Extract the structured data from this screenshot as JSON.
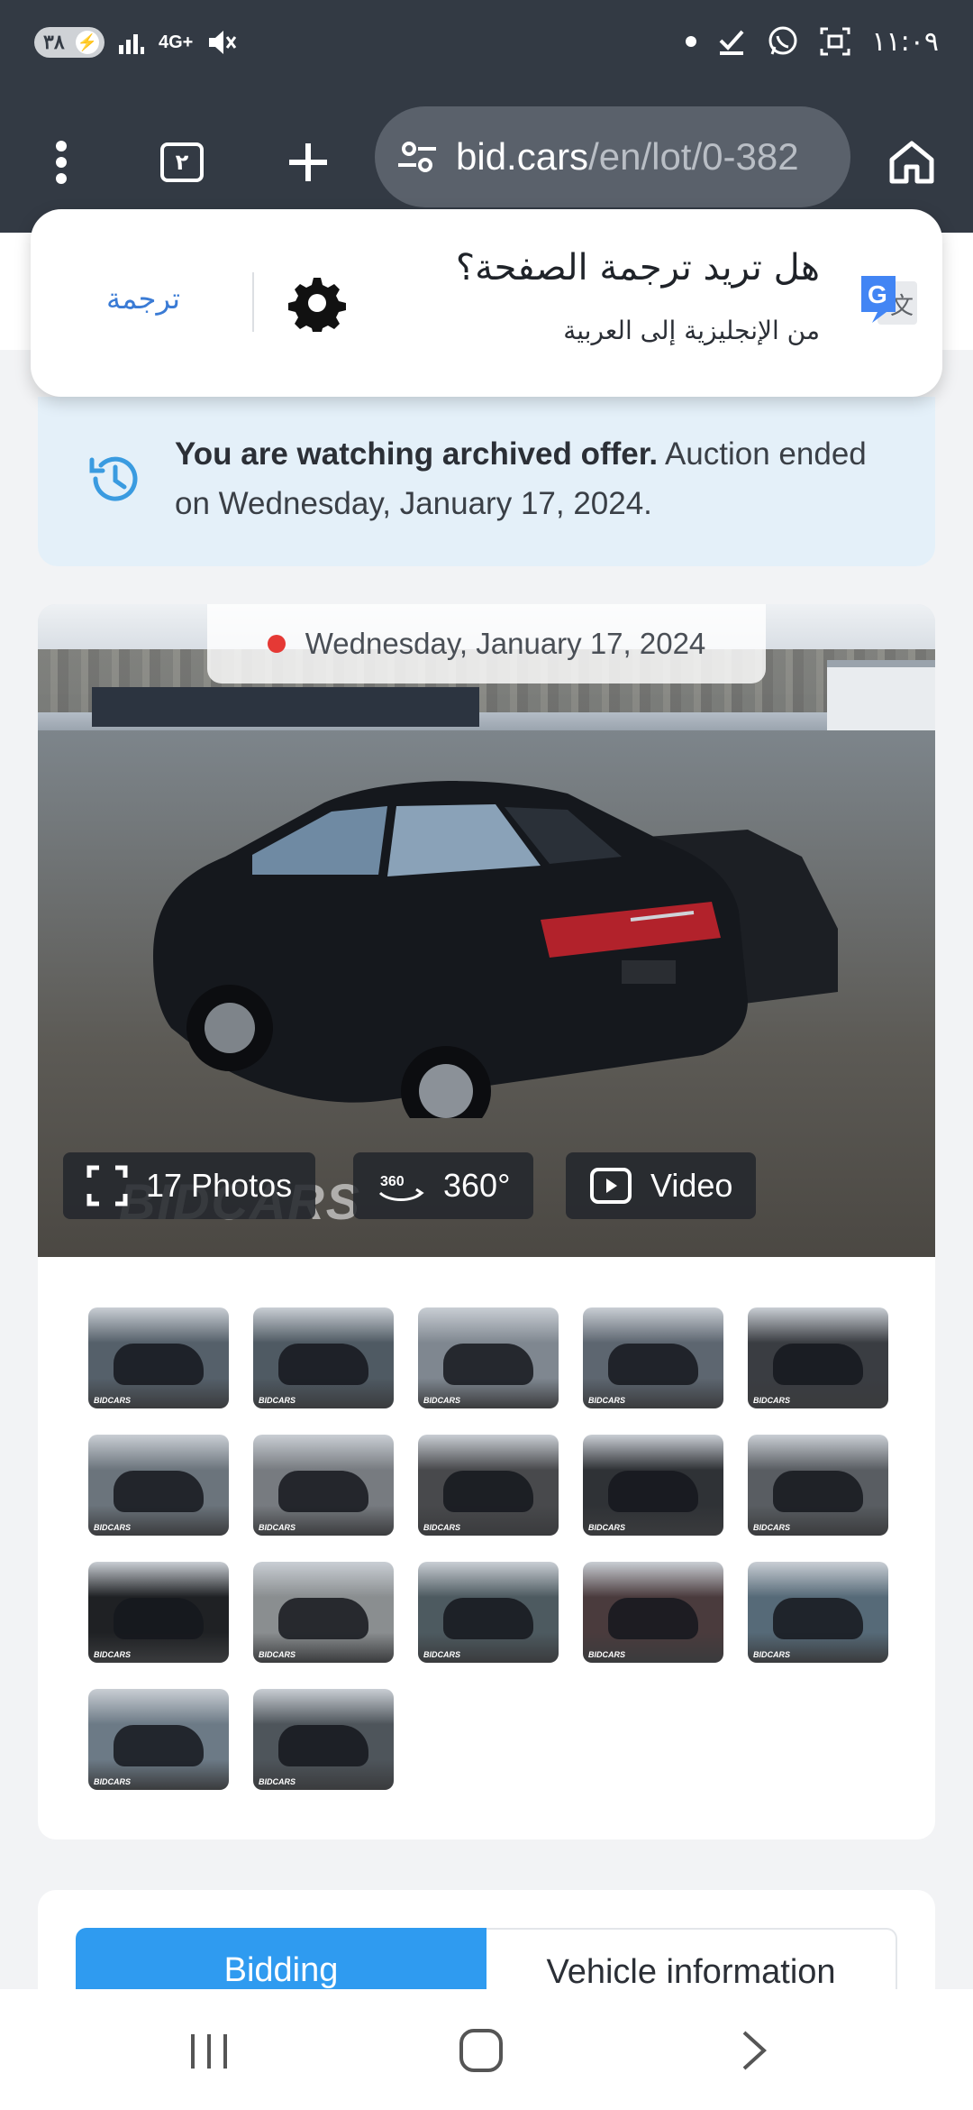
{
  "status_bar": {
    "battery": "٣٨",
    "network": "4G+",
    "time": "١١:٠٩"
  },
  "browser": {
    "tab_count": "٢",
    "url_host": "bid.cars",
    "url_path": "/en/lot/0-382"
  },
  "translate_popup": {
    "title": "هل تريد ترجمة الصفحة؟",
    "subtitle": "من الإنجليزية إلى العربية",
    "translate_button": "ترجمة"
  },
  "notice": {
    "bold": "You are watching archived offer.",
    "rest": " Auction ended on Wednesday, January 17, 2024."
  },
  "gallery": {
    "date": "Wednesday, January 17, 2024",
    "watermark": "BIDCARS",
    "photos_label": "17 Photos",
    "view360_label": "360°",
    "video_label": "Video",
    "thumb_watermark": "BIDCARS",
    "thumbnails": [
      {
        "name": "rear-left-view",
        "bg": "#55606a"
      },
      {
        "name": "front-right-view",
        "bg": "#4f5a63"
      },
      {
        "name": "side-view",
        "bg": "#7f8790"
      },
      {
        "name": "rear-view",
        "bg": "#5d6670"
      },
      {
        "name": "interior-door-open",
        "bg": "#3a3d42"
      },
      {
        "name": "rear-left-lot",
        "bg": "#6b747c"
      },
      {
        "name": "instrument-cluster",
        "bg": "#777b80"
      },
      {
        "name": "rear-seats",
        "bg": "#48494c"
      },
      {
        "name": "vin-sticker",
        "bg": "#2f3236"
      },
      {
        "name": "engine-bay",
        "bg": "#595d62"
      },
      {
        "name": "key-fob",
        "bg": "#1f2124"
      },
      {
        "name": "damaged-bumper",
        "bg": "#8a8e90"
      },
      {
        "name": "front-view",
        "bg": "#4d5a60"
      },
      {
        "name": "side-closeup",
        "bg": "#4a3b3d"
      },
      {
        "name": "front-left-lot",
        "bg": "#566a78"
      },
      {
        "name": "odometer",
        "bg": "#6c7a86"
      },
      {
        "name": "rear-lot-view",
        "bg": "#4e555b"
      }
    ]
  },
  "tabs": {
    "active": "Bidding",
    "inactive": "Vehicle information"
  },
  "colors": {
    "chrome": "#333a44",
    "accent": "#2f9bf0",
    "notice_bg": "#e4f0f9"
  }
}
